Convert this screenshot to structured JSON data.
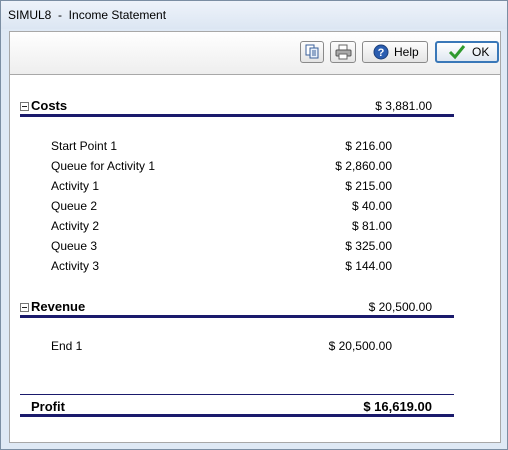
{
  "window": {
    "title": "SIMUL8  -  Income Statement"
  },
  "toolbar": {
    "help_label": "Help",
    "ok_label": "OK"
  },
  "costs": {
    "label": "Costs",
    "total": "$ 3,881.00",
    "items": [
      {
        "name": "Start Point 1",
        "amount": "$ 216.00"
      },
      {
        "name": "Queue for Activity 1",
        "amount": "$ 2,860.00"
      },
      {
        "name": "Activity 1",
        "amount": "$ 215.00"
      },
      {
        "name": "Queue 2",
        "amount": "$ 40.00"
      },
      {
        "name": "Activity 2",
        "amount": "$ 81.00"
      },
      {
        "name": "Queue 3",
        "amount": "$ 325.00"
      },
      {
        "name": "Activity 3",
        "amount": "$ 144.00"
      }
    ]
  },
  "revenue": {
    "label": "Revenue",
    "total": "$ 20,500.00",
    "items": [
      {
        "name": "End 1",
        "amount": "$ 20,500.00"
      }
    ]
  },
  "profit": {
    "label": "Profit",
    "total": "$ 16,619.00"
  },
  "colors": {
    "rule": "#1a1a6c",
    "ok_border": "#3a78b8",
    "window_bg": "#dfe9f5"
  },
  "icons": [
    "copy-icon",
    "print-icon",
    "help-icon",
    "checkmark-icon",
    "expand-collapse-icon"
  ]
}
